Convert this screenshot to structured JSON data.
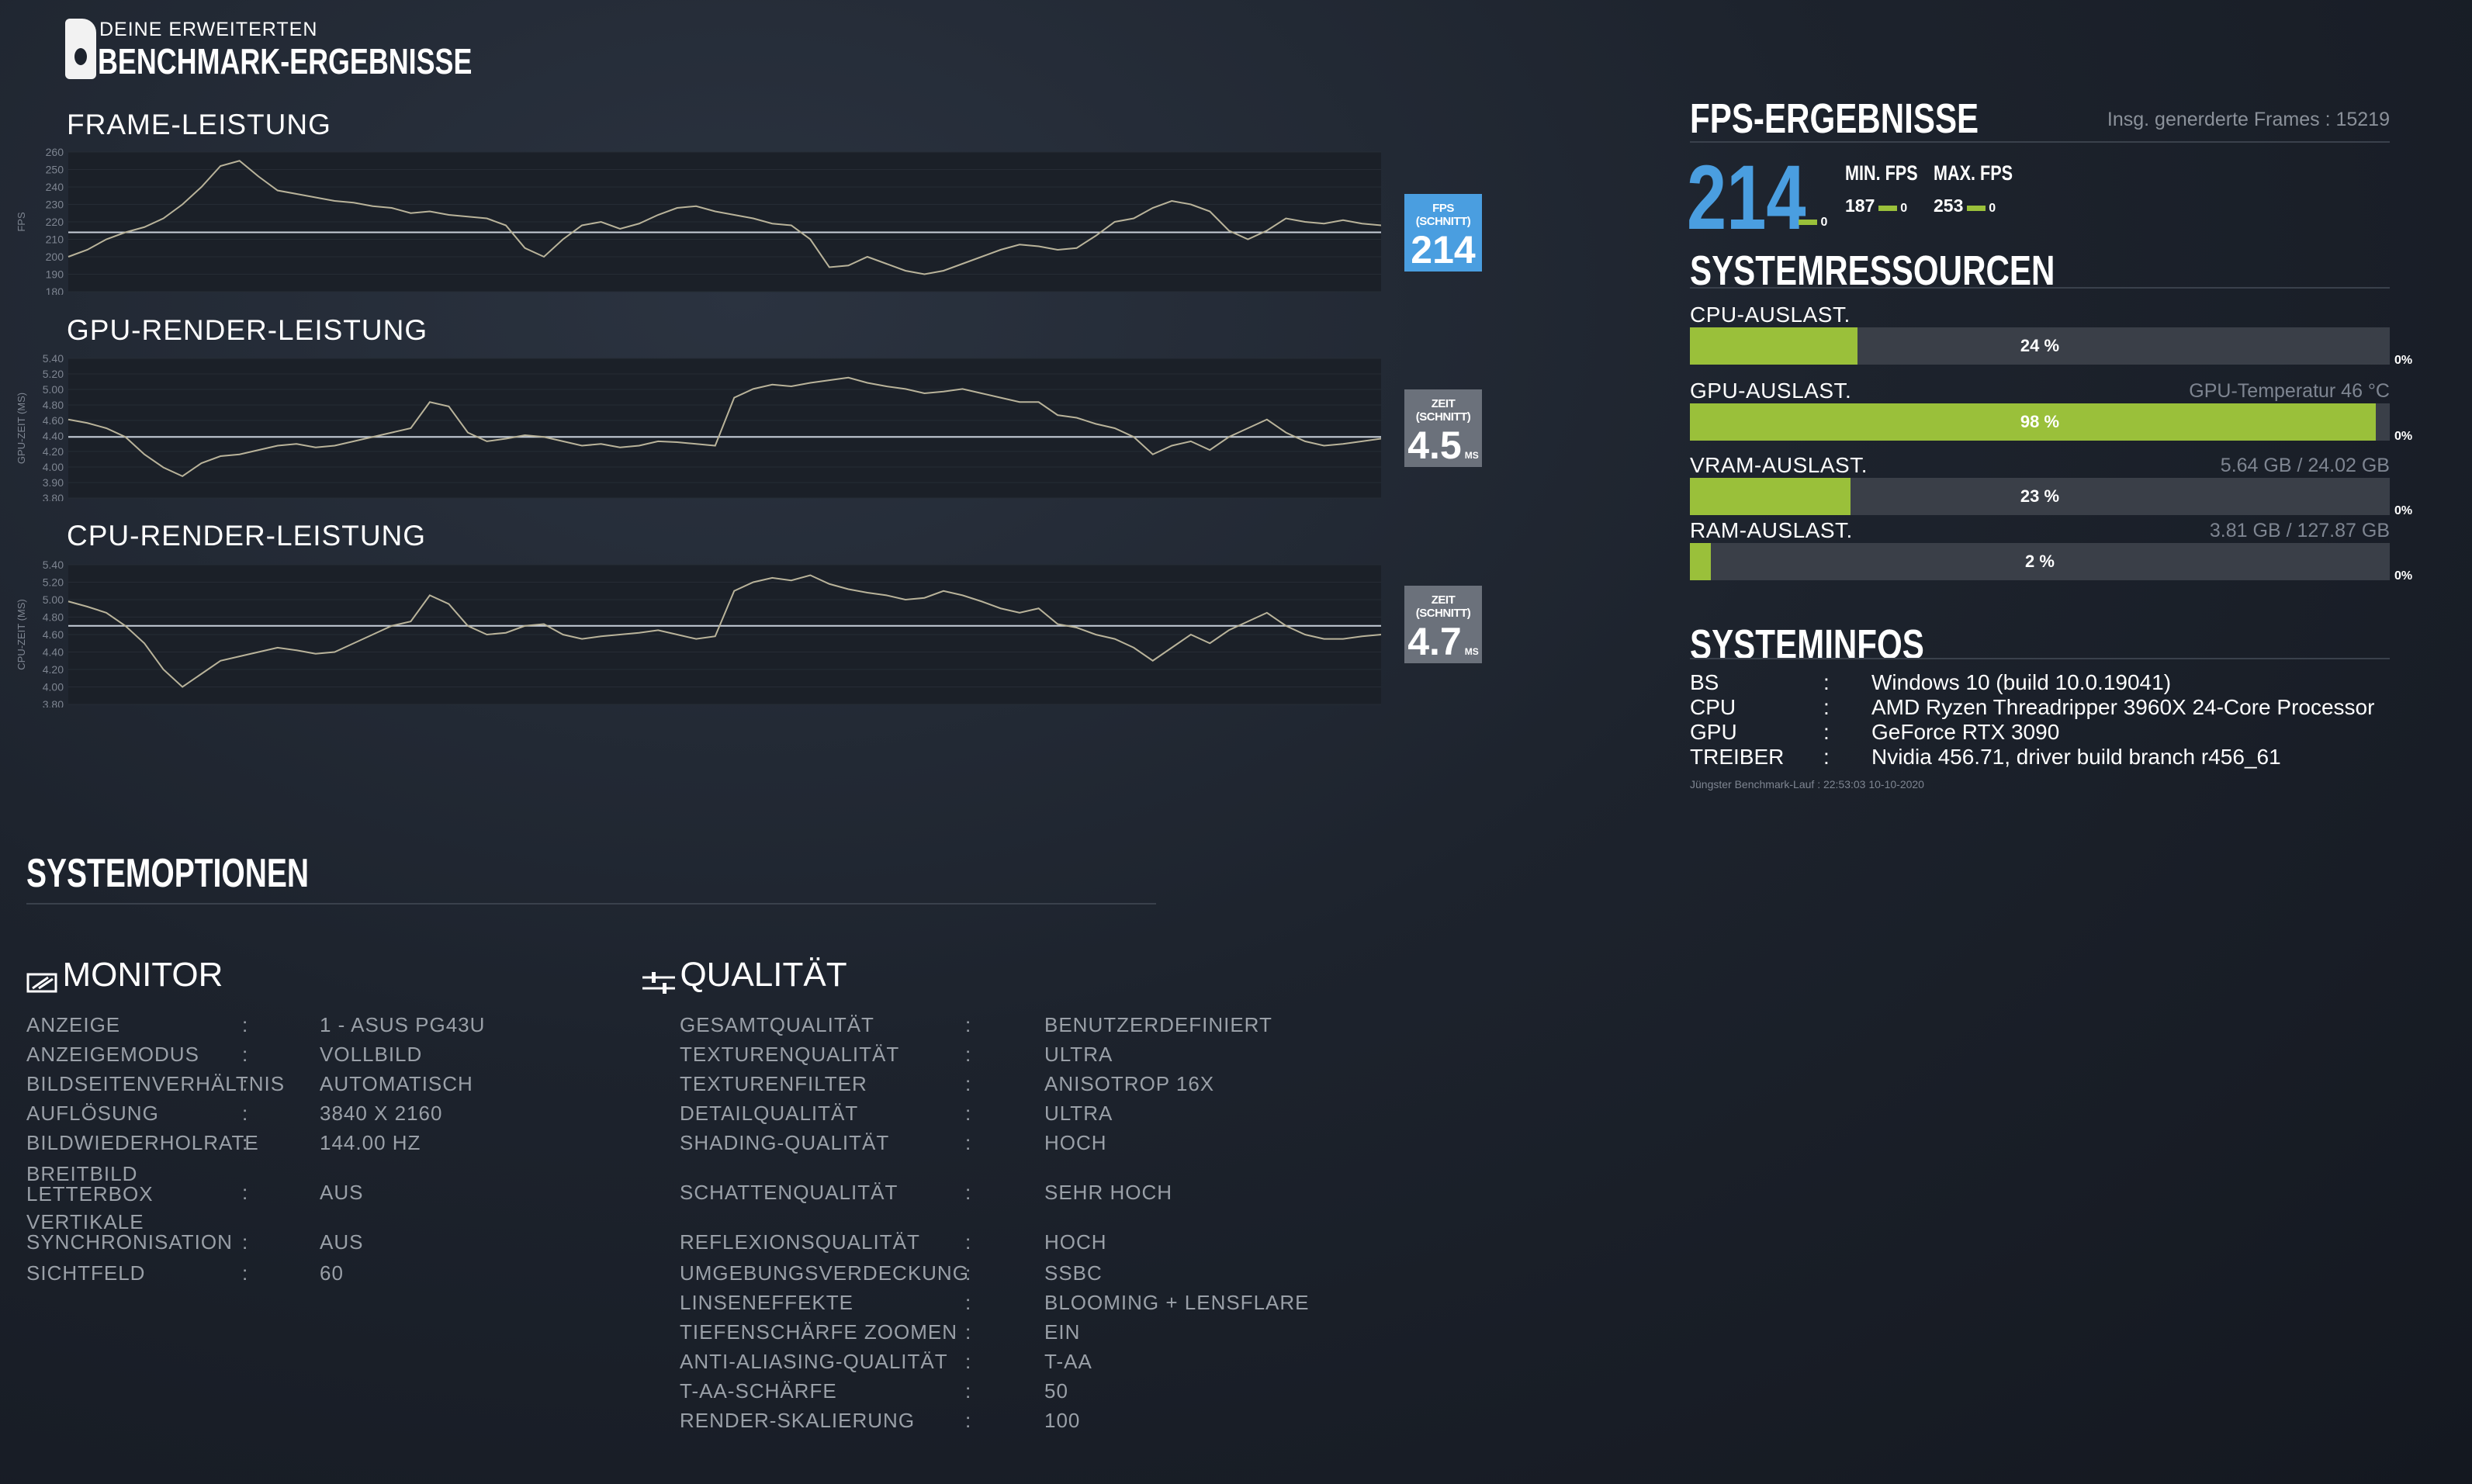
{
  "logo": {
    "line1": "DEINE ERWEITERTEN",
    "line2": "BENCHMARK-ERGEBNISSE"
  },
  "charts": {
    "fps": {
      "title": "FRAME-LEISTUNG",
      "ylabel": "FPS",
      "avg_label": "FPS (SCHNITT)",
      "avg_value": "214",
      "avg_unit": "",
      "avg_color": "#4a9ee0"
    },
    "gpu": {
      "title": "GPU-RENDER-LEISTUNG",
      "ylabel": "GPU-ZEIT (MS)",
      "avg_label": "ZEIT (SCHNITT)",
      "avg_value": "4.5",
      "avg_unit": "MS",
      "avg_color": "#6b717b"
    },
    "cpu": {
      "title": "CPU-RENDER-LEISTUNG",
      "ylabel": "CPU-ZEIT (MS)",
      "avg_label": "ZEIT (SCHNITT)",
      "avg_value": "4.7",
      "avg_unit": "MS",
      "avg_color": "#6b717b"
    }
  },
  "chart_data": [
    {
      "type": "line",
      "ylabel": "FPS",
      "ylim": [
        180,
        260
      ],
      "yticks": [
        "260",
        "250",
        "240",
        "230",
        "220",
        "210",
        "200",
        "190",
        "180"
      ],
      "average": 214,
      "values": [
        200,
        204,
        210,
        214,
        217,
        222,
        230,
        240,
        252,
        255,
        246,
        238,
        236,
        234,
        232,
        231,
        229,
        228,
        225,
        226,
        224,
        223,
        222,
        218,
        205,
        200,
        210,
        218,
        220,
        216,
        219,
        224,
        228,
        229,
        226,
        224,
        222,
        219,
        218,
        210,
        194,
        195,
        200,
        196,
        192,
        190,
        192,
        196,
        200,
        204,
        207,
        206,
        204,
        205,
        212,
        220,
        222,
        228,
        232,
        230,
        226,
        215,
        210,
        215,
        222,
        220,
        219,
        221,
        219,
        218
      ]
    },
    {
      "type": "line",
      "ylabel": "GPU-ZEIT (MS)",
      "ylim": [
        3.8,
        5.4
      ],
      "yticks": [
        "5.40",
        "5.20",
        "5.00",
        "4.80",
        "4.60",
        "4.40",
        "4.20",
        "4.00",
        "3.90",
        "3.80"
      ],
      "average": 4.5,
      "values": [
        4.7,
        4.66,
        4.6,
        4.5,
        4.3,
        4.15,
        4.05,
        4.2,
        4.28,
        4.3,
        4.35,
        4.4,
        4.42,
        4.38,
        4.4,
        4.45,
        4.5,
        4.55,
        4.6,
        4.9,
        4.85,
        4.55,
        4.45,
        4.48,
        4.52,
        4.5,
        4.45,
        4.4,
        4.42,
        4.38,
        4.4,
        4.45,
        4.44,
        4.42,
        4.4,
        4.95,
        5.05,
        5.1,
        5.08,
        5.12,
        5.15,
        5.18,
        5.12,
        5.08,
        5.05,
        5.0,
        5.02,
        5.05,
        5.0,
        4.95,
        4.9,
        4.9,
        4.75,
        4.72,
        4.65,
        4.6,
        4.5,
        4.3,
        4.4,
        4.45,
        4.35,
        4.5,
        4.6,
        4.7,
        4.55,
        4.45,
        4.4,
        4.42,
        4.45,
        4.48
      ]
    },
    {
      "type": "line",
      "ylabel": "CPU-ZEIT (MS)",
      "ylim": [
        3.8,
        5.4
      ],
      "yticks": [
        "5.40",
        "5.20",
        "5.00",
        "4.80",
        "4.60",
        "4.40",
        "4.20",
        "4.00",
        "3.80"
      ],
      "average": 4.7,
      "values": [
        4.98,
        4.92,
        4.85,
        4.7,
        4.5,
        4.2,
        4.0,
        4.15,
        4.3,
        4.35,
        4.4,
        4.45,
        4.42,
        4.38,
        4.4,
        4.5,
        4.6,
        4.7,
        4.75,
        5.05,
        4.95,
        4.7,
        4.6,
        4.62,
        4.7,
        4.72,
        4.6,
        4.55,
        4.58,
        4.6,
        4.62,
        4.65,
        4.6,
        4.55,
        4.58,
        5.1,
        5.2,
        5.25,
        5.22,
        5.28,
        5.18,
        5.12,
        5.08,
        5.05,
        5.0,
        5.02,
        5.1,
        5.05,
        4.98,
        4.9,
        4.85,
        4.9,
        4.72,
        4.68,
        4.6,
        4.55,
        4.45,
        4.3,
        4.45,
        4.6,
        4.5,
        4.65,
        4.75,
        4.85,
        4.7,
        4.6,
        4.55,
        4.55,
        4.58,
        4.6
      ]
    }
  ],
  "fps_results": {
    "title": "FPS-ERGEBNISSE",
    "total_frames": "Insg. generderte Frames : 15219",
    "avg": "214",
    "avg_marker": "0",
    "min_label": "MIN. FPS",
    "min_value": "187",
    "min_marker": "0",
    "max_label": "MAX. FPS",
    "max_value": "253",
    "max_marker": "0"
  },
  "resources": {
    "title": "SYSTEMRESSOURCEN",
    "items": [
      {
        "label": "CPU-AUSLAST.",
        "extra": "",
        "percent": 24,
        "pct_text": "24 %",
        "zero": "0%"
      },
      {
        "label": "GPU-AUSLAST.",
        "extra": "GPU-Temperatur 46 °C",
        "percent": 98,
        "pct_text": "98 %",
        "zero": "0%"
      },
      {
        "label": "VRAM-AUSLAST.",
        "extra": "5.64 GB / 24.02 GB",
        "percent": 23,
        "pct_text": "23 %",
        "zero": "0%"
      },
      {
        "label": "RAM-AUSLAST.",
        "extra": "3.81 GB / 127.87 GB",
        "percent": 3,
        "pct_text": "2 %",
        "zero": "0%"
      }
    ]
  },
  "sysinfo": {
    "title": "SYSTEMINFOS",
    "rows": [
      {
        "key": "BS",
        "value": "Windows 10 (build 10.0.19041)"
      },
      {
        "key": "CPU",
        "value": "AMD Ryzen Threadripper 3960X 24-Core Processor"
      },
      {
        "key": "GPU",
        "value": "GeForce RTX 3090"
      },
      {
        "key": "TREIBER",
        "value": "Nvidia 456.71, driver build branch r456_61"
      }
    ],
    "colon": ":",
    "last_run": "Jüngster Benchmark-Lauf : 22:53:03 10-10-2020"
  },
  "options": {
    "title": "SYSTEMOPTIONEN",
    "colon": ":",
    "monitor": {
      "title": "MONITOR",
      "rows": [
        {
          "label": "ANZEIGE",
          "value": "1 - ASUS PG43U"
        },
        {
          "label": "ANZEIGEMODUS",
          "value": "VOLLBILD"
        },
        {
          "label": "BILDSEITENVERHÄLTNIS",
          "value": "AUTOMATISCH"
        },
        {
          "label": "AUFLÖSUNG",
          "value": "3840 X 2160"
        },
        {
          "label": "BILDWIEDERHOLRATE",
          "value": "144.00 HZ"
        },
        {
          "label": "BREITBILD LETTERBOX",
          "value": "AUS"
        },
        {
          "label": "VERTIKALE SYNCHRONISATION",
          "value": "AUS"
        },
        {
          "label": "SICHTFELD",
          "value": "60"
        }
      ]
    },
    "quality": {
      "title": "QUALITÄT",
      "rows": [
        {
          "label": "GESAMTQUALITÄT",
          "value": "BENUTZERDEFINIERT"
        },
        {
          "label": "TEXTURENQUALITÄT",
          "value": "ULTRA"
        },
        {
          "label": "TEXTURENFILTER",
          "value": "ANISOTROP 16X"
        },
        {
          "label": "DETAILQUALITÄT",
          "value": "ULTRA"
        },
        {
          "label": "SHADING-QUALITÄT",
          "value": "HOCH"
        },
        {
          "label": "SCHATTENQUALITÄT",
          "value": "SEHR HOCH"
        },
        {
          "label": "REFLEXIONSQUALITÄT",
          "value": "HOCH"
        },
        {
          "label": "UMGEBUNGSVERDECKUNG",
          "value": "SSBC"
        },
        {
          "label": "LINSENEFFEKTE",
          "value": "BLOOMING + LENSFLARE"
        },
        {
          "label": "TIEFENSCHÄRFE ZOOMEN",
          "value": "EIN"
        },
        {
          "label": "ANTI-ALIASING-QUALITÄT",
          "value": "T-AA"
        },
        {
          "label": "T-AA-SCHÄRFE",
          "value": "50"
        },
        {
          "label": "RENDER-SKALIERUNG",
          "value": "100"
        }
      ]
    }
  }
}
